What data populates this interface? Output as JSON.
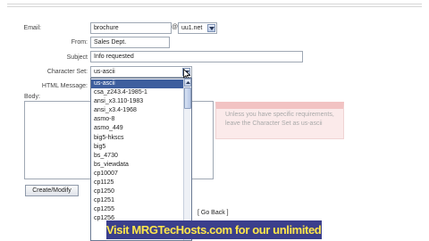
{
  "form": {
    "email_label": "Email:",
    "email_value": "brochure",
    "at_sign": "@",
    "domain_value": "uu1.net",
    "from_label": "From:",
    "from_value": "Sales Dept.",
    "subject_label": "Subject",
    "subject_value": "Info requested",
    "charset_label": "Character Set:",
    "charset_value": "us-ascii",
    "html_label": "HTML Message:",
    "body_label": "Body:",
    "submit_label": "Create/Modify",
    "go_back_label": "[ Go Back ]"
  },
  "dropdown": {
    "options": [
      "us-ascii",
      "csa_z243.4-1985-1",
      "ansi_x3.110-1983",
      "ansi_x3.4-1968",
      "asmo-8",
      "asmo_449",
      "big5-hkscs",
      "big5",
      "bs_4730",
      "bs_viewdata",
      "cp10007",
      "cp1125",
      "cp1250",
      "cp1251",
      "cp1255",
      "cp1256"
    ],
    "selected_index": 0
  },
  "tooltip": {
    "text": "Unless you have specific requirements, leave the Character Set as us-ascii"
  },
  "banner": {
    "text": "Visit MRGTecHosts.com for our unlimited $69 package!"
  },
  "colors": {
    "selection": "#3e5f9e",
    "banner_bg": "#3b3f8c",
    "banner_text": "#ffe74a"
  }
}
